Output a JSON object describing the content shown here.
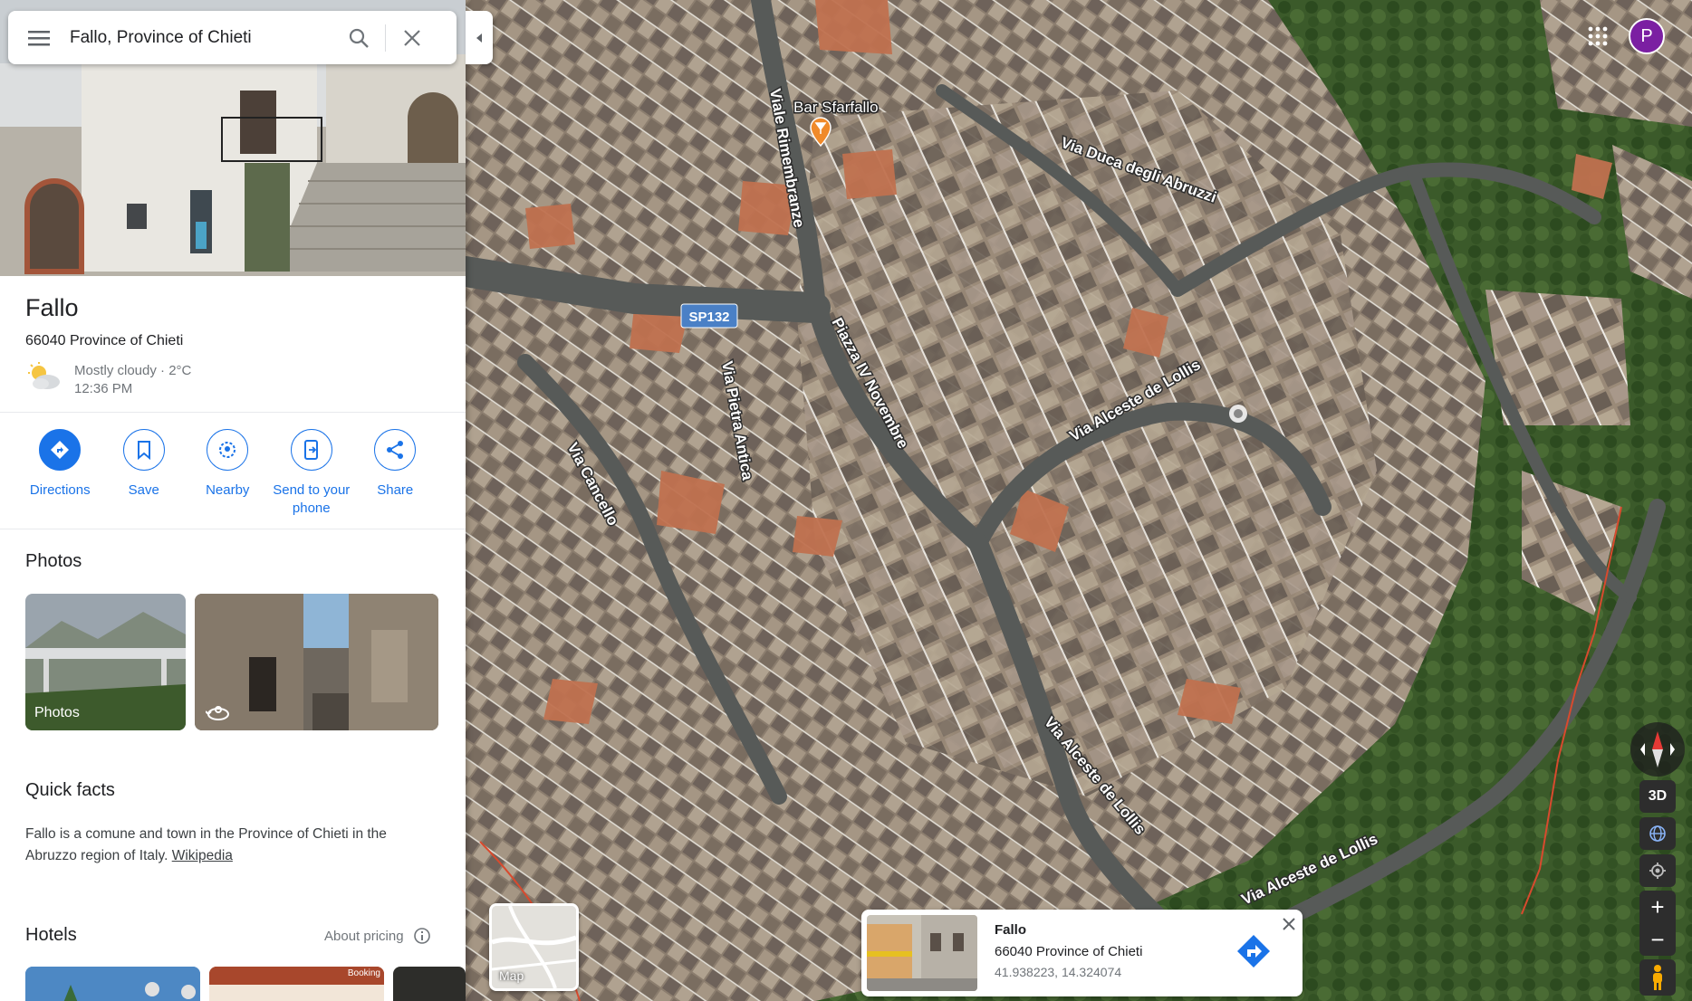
{
  "search": {
    "value": "Fallo, Province of Chieti",
    "menu_icon": "menu-icon",
    "search_icon": "search-icon",
    "close_icon": "close-icon"
  },
  "place": {
    "title": "Fallo",
    "address": "66040 Province of Chieti",
    "weather": {
      "condition": "Mostly cloudy · 2°C",
      "time": "12:36 PM",
      "icon": "partly-cloudy-icon"
    }
  },
  "actions": [
    {
      "label": "Directions",
      "icon": "directions-icon"
    },
    {
      "label": "Save",
      "icon": "bookmark-icon"
    },
    {
      "label": "Nearby",
      "icon": "nearby-icon"
    },
    {
      "label": "Send to your phone",
      "icon": "send-to-phone-icon"
    },
    {
      "label": "Share",
      "icon": "share-icon"
    }
  ],
  "photos": {
    "title": "Photos",
    "photo1_label": "Photos"
  },
  "quick_facts": {
    "title": "Quick facts",
    "text": "Fallo is a comune and town in the Province of Chieti in the Abruzzo region of Italy. ",
    "link": "Wikipedia"
  },
  "hotels": {
    "title": "Hotels",
    "about_pricing": "About pricing",
    "booking_badge": "Booking"
  },
  "map": {
    "labels": {
      "bar": "Bar Sfarfallo",
      "road_sp": "SP132",
      "viale": "Viale Rimembranze",
      "piazza": "Piazza IV Novembre",
      "pietra": "Via Pietra Antica",
      "cancello": "Via Cancello",
      "duca": "Via Duca degli Abruzzi",
      "alceste1": "Via Alceste de Lollis",
      "alceste2": "Via Alceste de Lollis",
      "alceste3": "Via Alceste de Lollis"
    },
    "layer_label": "Map"
  },
  "controls": {
    "three_d": "3D",
    "zoom_in": "+",
    "zoom_out": "−",
    "avatar": "P"
  },
  "infocard": {
    "title": "Fallo",
    "address": "66040 Province of Chieti",
    "coords": "41.938223, 14.324074"
  },
  "colors": {
    "accent": "#1a73e8",
    "avatar": "#7b1fa2"
  }
}
